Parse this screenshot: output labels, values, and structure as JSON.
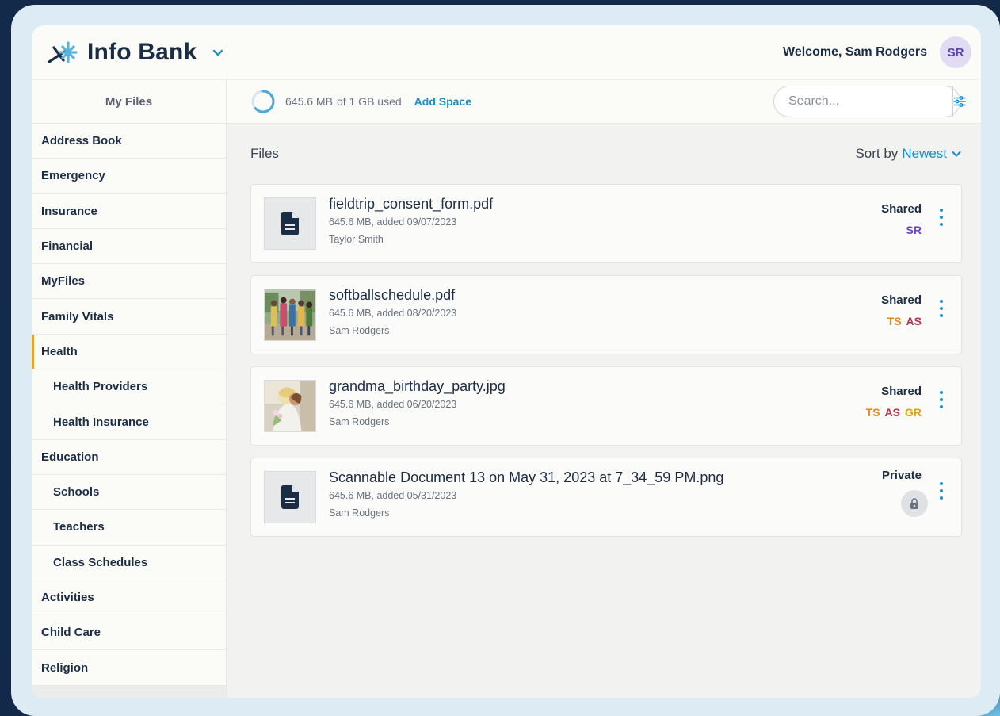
{
  "header": {
    "app_title": "Info Bank",
    "welcome": "Welcome, Sam Rodgers",
    "avatar_initials": "SR"
  },
  "sidebar": {
    "heading": "My Files",
    "items": [
      {
        "label": "Address Book",
        "sub": false
      },
      {
        "label": "Emergency",
        "sub": false
      },
      {
        "label": "Insurance",
        "sub": false
      },
      {
        "label": "Financial",
        "sub": false
      },
      {
        "label": "MyFiles",
        "sub": false
      },
      {
        "label": "Family Vitals",
        "sub": false
      },
      {
        "label": "Health",
        "sub": false,
        "active": true
      },
      {
        "label": "Health Providers",
        "sub": true
      },
      {
        "label": "Health Insurance",
        "sub": true
      },
      {
        "label": "Education",
        "sub": false
      },
      {
        "label": "Schools",
        "sub": true
      },
      {
        "label": "Teachers",
        "sub": true
      },
      {
        "label": "Class Schedules",
        "sub": true
      },
      {
        "label": "Activities",
        "sub": false
      },
      {
        "label": "Child Care",
        "sub": false
      },
      {
        "label": "Religion",
        "sub": false
      }
    ]
  },
  "toolbar": {
    "storage_used": "645.6 MB",
    "storage_total": "of 1 GB used",
    "storage_fraction": 0.63,
    "add_space_label": "Add Space",
    "search_placeholder": "Search..."
  },
  "main": {
    "title": "Files",
    "sort_label": "Sort by",
    "sort_value": "Newest",
    "files": [
      {
        "name": "fieldtrip_consent_form.pdf",
        "meta": "645.6 MB, added 09/07/2023",
        "owner": "Taylor Smith",
        "thumb": "document-icon",
        "status": "Shared",
        "shared_with": [
          {
            "initials": "SR",
            "color": "#6a3fc8"
          }
        ]
      },
      {
        "name": "softballschedule.pdf",
        "meta": "645.6 MB, added 08/20/2023",
        "owner": "Sam Rodgers",
        "thumb": "photo-kids-walking",
        "status": "Shared",
        "shared_with": [
          {
            "initials": "TS",
            "color": "#e08a1e"
          },
          {
            "initials": "AS",
            "color": "#b8334a"
          }
        ]
      },
      {
        "name": "grandma_birthday_party.jpg",
        "meta": "645.6 MB, added 06/20/2023",
        "owner": "Sam Rodgers",
        "thumb": "photo-hug",
        "status": "Shared",
        "shared_with": [
          {
            "initials": "TS",
            "color": "#e08a1e"
          },
          {
            "initials": "AS",
            "color": "#b8334a"
          },
          {
            "initials": "GR",
            "color": "#d8a21c"
          }
        ]
      },
      {
        "name": "Scannable Document 13 on May 31, 2023 at 7_34_59 PM.png",
        "meta": "645.6 MB, added 05/31/2023",
        "owner": "Sam Rodgers",
        "thumb": "document-icon",
        "status": "Private",
        "shared_with": []
      }
    ]
  },
  "colors": {
    "navy": "#1b2c45",
    "accent_blue": "#1d8fc7",
    "active_marker": "#e3a530"
  }
}
